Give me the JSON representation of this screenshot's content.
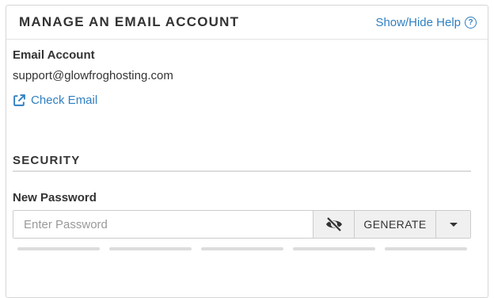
{
  "header": {
    "title": "MANAGE AN EMAIL ACCOUNT",
    "help_label": "Show/Hide Help",
    "help_icon": "question-circle-icon"
  },
  "account": {
    "label": "Email Account",
    "value": "support@glowfroghosting.com",
    "check_email_label": "Check Email",
    "check_email_icon": "external-link-icon"
  },
  "security": {
    "title": "SECURITY",
    "new_password_label": "New Password",
    "password_placeholder": "Enter Password",
    "password_value": "",
    "toggle_icon": "eye-slash-icon",
    "generate_label": "GENERATE",
    "dropdown_icon": "caret-down-icon",
    "strength_segments": 5,
    "strength_filled": 0
  },
  "colors": {
    "link": "#2f7fc1",
    "text": "#333333",
    "border": "#cccccc",
    "button_bg": "#f0f0f0",
    "meter_empty": "#dcdcdc"
  }
}
